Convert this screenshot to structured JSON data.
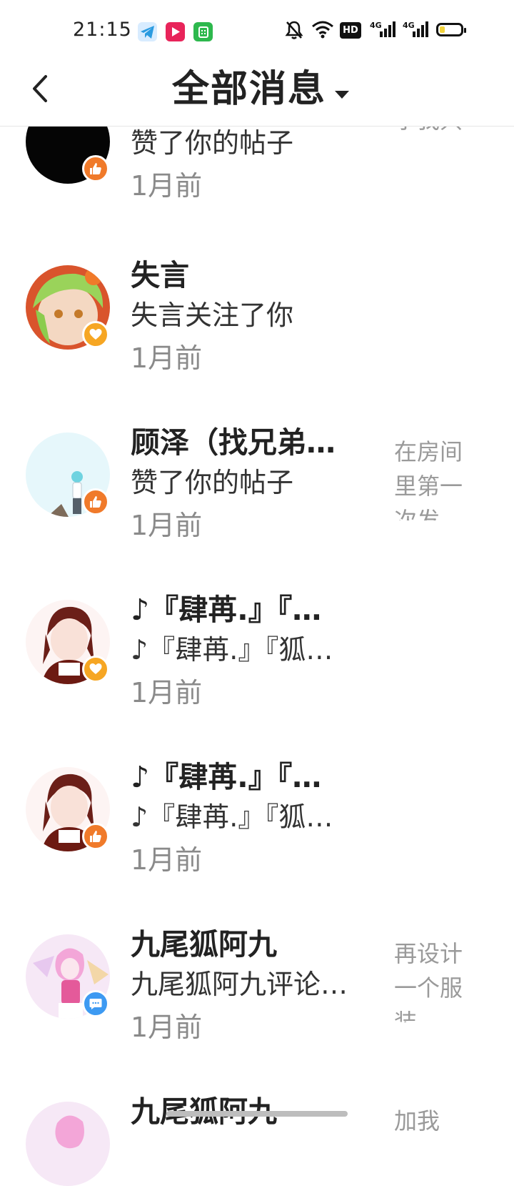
{
  "status_bar": {
    "time": "21:15",
    "hd_label": "HD",
    "battery_level": 0.25,
    "battery_color": "#f2d33b"
  },
  "header": {
    "title": "全部消息"
  },
  "messages": [
    {
      "name": "",
      "action": "赞了你的帖子",
      "time": "1月前",
      "preview": "不够个字我只",
      "type": "like"
    },
    {
      "name": "失言",
      "action": "失言关注了你",
      "time": "1月前",
      "preview": "",
      "type": "follow"
    },
    {
      "name": "顾泽（找兄弟…",
      "action": "赞了你的帖子",
      "time": "1月前",
      "preview": "在房间里第一次发",
      "type": "like"
    },
    {
      "name": "♪『肆苒.』『…",
      "action": "♪『肆苒.』『狐…",
      "time": "1月前",
      "preview": "",
      "type": "follow"
    },
    {
      "name": "♪『肆苒.』『…",
      "action": "♪『肆苒.』『狐…",
      "time": "1月前",
      "preview": "",
      "type": "like"
    },
    {
      "name": "九尾狐阿九",
      "action": "九尾狐阿九评论…",
      "time": "1月前",
      "preview": "再设计一个服装",
      "type": "comment"
    },
    {
      "name": "九尾狐阿九",
      "action": "",
      "time": "",
      "preview": "加我",
      "type": "comment"
    }
  ],
  "colors": {
    "like_badge": "#f07a2a",
    "follow_badge": "#f6a623",
    "comment_badge": "#3d9af2"
  }
}
